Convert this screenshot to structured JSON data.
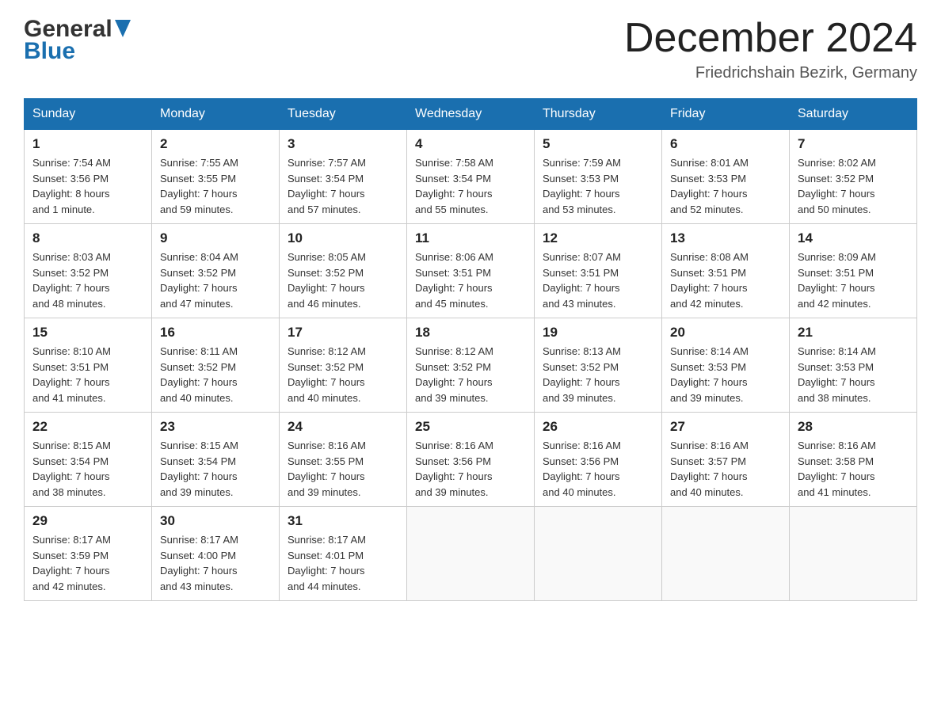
{
  "header": {
    "month_title": "December 2024",
    "location": "Friedrichshain Bezirk, Germany",
    "logo_general": "General",
    "logo_blue": "Blue"
  },
  "days_of_week": [
    "Sunday",
    "Monday",
    "Tuesday",
    "Wednesday",
    "Thursday",
    "Friday",
    "Saturday"
  ],
  "weeks": [
    [
      {
        "day": "1",
        "sunrise": "7:54 AM",
        "sunset": "3:56 PM",
        "daylight": "8 hours and 1 minute."
      },
      {
        "day": "2",
        "sunrise": "7:55 AM",
        "sunset": "3:55 PM",
        "daylight": "7 hours and 59 minutes."
      },
      {
        "day": "3",
        "sunrise": "7:57 AM",
        "sunset": "3:54 PM",
        "daylight": "7 hours and 57 minutes."
      },
      {
        "day": "4",
        "sunrise": "7:58 AM",
        "sunset": "3:54 PM",
        "daylight": "7 hours and 55 minutes."
      },
      {
        "day": "5",
        "sunrise": "7:59 AM",
        "sunset": "3:53 PM",
        "daylight": "7 hours and 53 minutes."
      },
      {
        "day": "6",
        "sunrise": "8:01 AM",
        "sunset": "3:53 PM",
        "daylight": "7 hours and 52 minutes."
      },
      {
        "day": "7",
        "sunrise": "8:02 AM",
        "sunset": "3:52 PM",
        "daylight": "7 hours and 50 minutes."
      }
    ],
    [
      {
        "day": "8",
        "sunrise": "8:03 AM",
        "sunset": "3:52 PM",
        "daylight": "7 hours and 48 minutes."
      },
      {
        "day": "9",
        "sunrise": "8:04 AM",
        "sunset": "3:52 PM",
        "daylight": "7 hours and 47 minutes."
      },
      {
        "day": "10",
        "sunrise": "8:05 AM",
        "sunset": "3:52 PM",
        "daylight": "7 hours and 46 minutes."
      },
      {
        "day": "11",
        "sunrise": "8:06 AM",
        "sunset": "3:51 PM",
        "daylight": "7 hours and 45 minutes."
      },
      {
        "day": "12",
        "sunrise": "8:07 AM",
        "sunset": "3:51 PM",
        "daylight": "7 hours and 43 minutes."
      },
      {
        "day": "13",
        "sunrise": "8:08 AM",
        "sunset": "3:51 PM",
        "daylight": "7 hours and 42 minutes."
      },
      {
        "day": "14",
        "sunrise": "8:09 AM",
        "sunset": "3:51 PM",
        "daylight": "7 hours and 42 minutes."
      }
    ],
    [
      {
        "day": "15",
        "sunrise": "8:10 AM",
        "sunset": "3:51 PM",
        "daylight": "7 hours and 41 minutes."
      },
      {
        "day": "16",
        "sunrise": "8:11 AM",
        "sunset": "3:52 PM",
        "daylight": "7 hours and 40 minutes."
      },
      {
        "day": "17",
        "sunrise": "8:12 AM",
        "sunset": "3:52 PM",
        "daylight": "7 hours and 40 minutes."
      },
      {
        "day": "18",
        "sunrise": "8:12 AM",
        "sunset": "3:52 PM",
        "daylight": "7 hours and 39 minutes."
      },
      {
        "day": "19",
        "sunrise": "8:13 AM",
        "sunset": "3:52 PM",
        "daylight": "7 hours and 39 minutes."
      },
      {
        "day": "20",
        "sunrise": "8:14 AM",
        "sunset": "3:53 PM",
        "daylight": "7 hours and 39 minutes."
      },
      {
        "day": "21",
        "sunrise": "8:14 AM",
        "sunset": "3:53 PM",
        "daylight": "7 hours and 38 minutes."
      }
    ],
    [
      {
        "day": "22",
        "sunrise": "8:15 AM",
        "sunset": "3:54 PM",
        "daylight": "7 hours and 38 minutes."
      },
      {
        "day": "23",
        "sunrise": "8:15 AM",
        "sunset": "3:54 PM",
        "daylight": "7 hours and 39 minutes."
      },
      {
        "day": "24",
        "sunrise": "8:16 AM",
        "sunset": "3:55 PM",
        "daylight": "7 hours and 39 minutes."
      },
      {
        "day": "25",
        "sunrise": "8:16 AM",
        "sunset": "3:56 PM",
        "daylight": "7 hours and 39 minutes."
      },
      {
        "day": "26",
        "sunrise": "8:16 AM",
        "sunset": "3:56 PM",
        "daylight": "7 hours and 40 minutes."
      },
      {
        "day": "27",
        "sunrise": "8:16 AM",
        "sunset": "3:57 PM",
        "daylight": "7 hours and 40 minutes."
      },
      {
        "day": "28",
        "sunrise": "8:16 AM",
        "sunset": "3:58 PM",
        "daylight": "7 hours and 41 minutes."
      }
    ],
    [
      {
        "day": "29",
        "sunrise": "8:17 AM",
        "sunset": "3:59 PM",
        "daylight": "7 hours and 42 minutes."
      },
      {
        "day": "30",
        "sunrise": "8:17 AM",
        "sunset": "4:00 PM",
        "daylight": "7 hours and 43 minutes."
      },
      {
        "day": "31",
        "sunrise": "8:17 AM",
        "sunset": "4:01 PM",
        "daylight": "7 hours and 44 minutes."
      },
      null,
      null,
      null,
      null
    ]
  ],
  "labels": {
    "sunrise": "Sunrise:",
    "sunset": "Sunset:",
    "daylight": "Daylight:"
  }
}
